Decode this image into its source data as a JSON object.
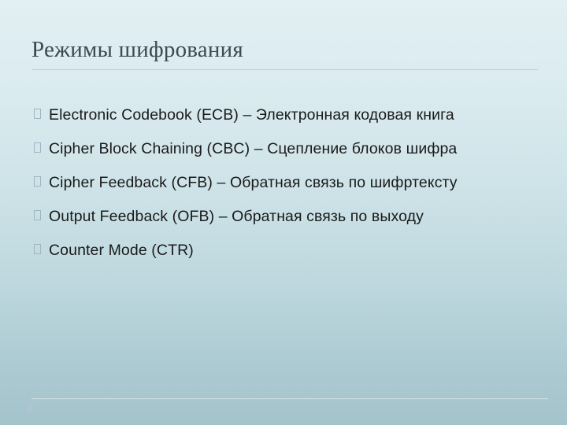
{
  "slide": {
    "title": "Режимы шифрования",
    "bullets": [
      {
        "marker": "tofu-box-bullet",
        "text": "Electronic Codebook (ECB) – Электронная кодовая книга",
        "wraps": true
      },
      {
        "marker": "tofu-box-bullet",
        "text": "Cipher Block Chaining (CBC) – Сцепление блоков шифра",
        "wraps": true
      },
      {
        "marker": "tofu-box-bullet",
        "text": "Cipher Feedback (CFB) – Обратная связь по шифртексту",
        "wraps": true
      },
      {
        "marker": "tofu-box-bullet",
        "text": "Output Feedback (OFB) – Обратная связь по выходу",
        "wraps": false
      },
      {
        "marker": "tofu-box-bullet",
        "text": "Counter Mode (CTR)",
        "wraps": false
      }
    ],
    "footer": {
      "rule": "horizontal-divider",
      "marker": "triangle-marker"
    },
    "colors": {
      "background_top": "#e2eff3",
      "background_bottom": "#a4c3cb",
      "title_text": "#3c4a52",
      "body_text": "#1a1a1a",
      "rule": "#c2cfd4",
      "bullet_marker": "#9fb6bf",
      "footer_marker": "#aec6d3"
    }
  }
}
